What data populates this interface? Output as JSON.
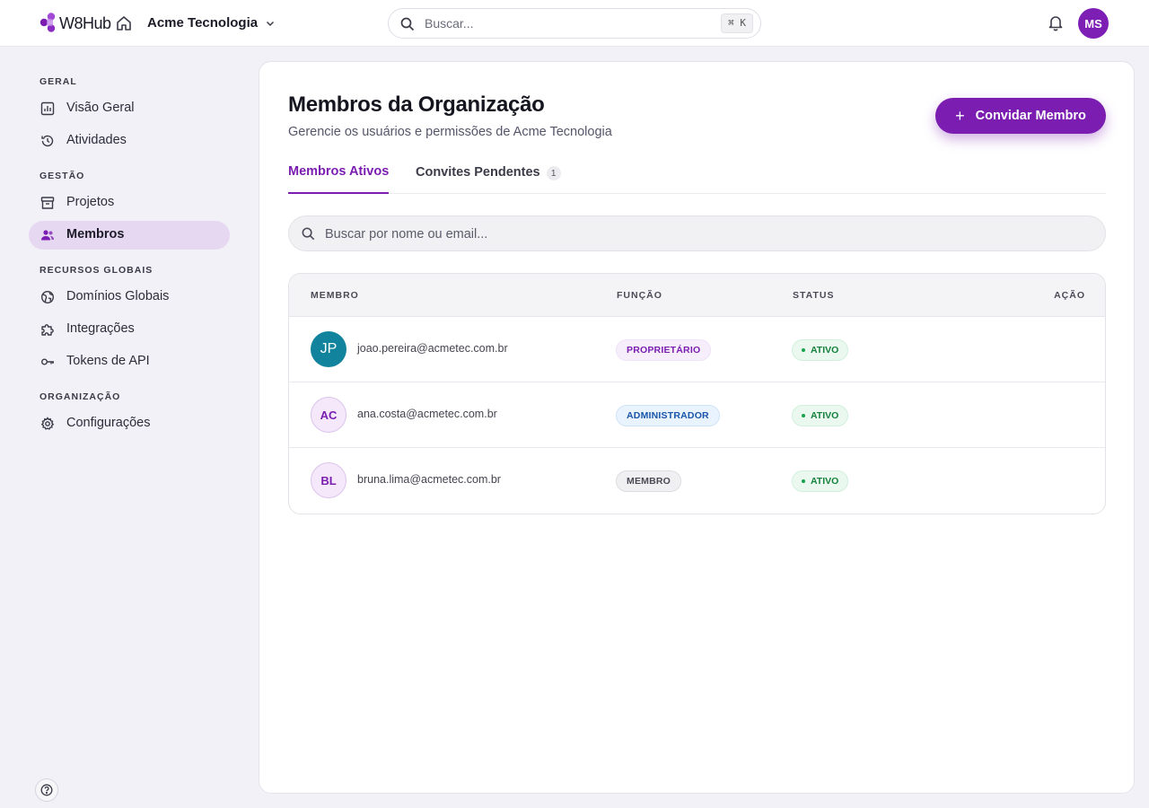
{
  "app": {
    "name": "W8Hub"
  },
  "header": {
    "org_name": "Acme Tecnologia",
    "search_placeholder": "Buscar...",
    "shortcut": "⌘ K",
    "user_initials": "MS",
    "colors": {
      "accent": "#7a1db0"
    }
  },
  "sidebar": {
    "sections": [
      {
        "title": "GERAL",
        "items": [
          {
            "label": "Visão Geral",
            "icon": "chart-icon"
          },
          {
            "label": "Atividades",
            "icon": "history-icon"
          }
        ]
      },
      {
        "title": "GESTÃO",
        "items": [
          {
            "label": "Projetos",
            "icon": "archive-icon"
          },
          {
            "label": "Membros",
            "icon": "users-icon",
            "active": true
          }
        ]
      },
      {
        "title": "RECURSOS GLOBAIS",
        "items": [
          {
            "label": "Domínios Globais",
            "icon": "globe-icon"
          },
          {
            "label": "Integrações",
            "icon": "puzzle-icon"
          },
          {
            "label": "Tokens de API",
            "icon": "key-icon"
          }
        ]
      },
      {
        "title": "ORGANIZAÇÃO",
        "items": [
          {
            "label": "Configurações",
            "icon": "gear-icon"
          }
        ]
      }
    ]
  },
  "main": {
    "title": "Membros da Organização",
    "subtitle": "Gerencie os usuários e permissões de Acme Tecnologia",
    "invite_label": "Convidar Membro",
    "tabs": [
      {
        "label": "Membros Ativos",
        "active": true
      },
      {
        "label": "Convites Pendentes",
        "count": "1"
      }
    ],
    "search_placeholder": "Buscar por nome ou email...",
    "table": {
      "headers": {
        "member": "MEMBRO",
        "role": "FUNÇÃO",
        "status": "STATUS",
        "action": "AÇÃO"
      },
      "rows": [
        {
          "initials": "JP",
          "email": "joao.pereira@acmetec.com.br",
          "role": "PROPRIETÁRIO",
          "status": "ATIVO"
        },
        {
          "initials": "AC",
          "email": "ana.costa@acmetec.com.br",
          "role": "ADMINISTRADOR",
          "status": "ATIVO"
        },
        {
          "initials": "BL",
          "email": "bruna.lima@acmetec.com.br",
          "role": "MEMBRO",
          "status": "ATIVO"
        }
      ]
    }
  }
}
